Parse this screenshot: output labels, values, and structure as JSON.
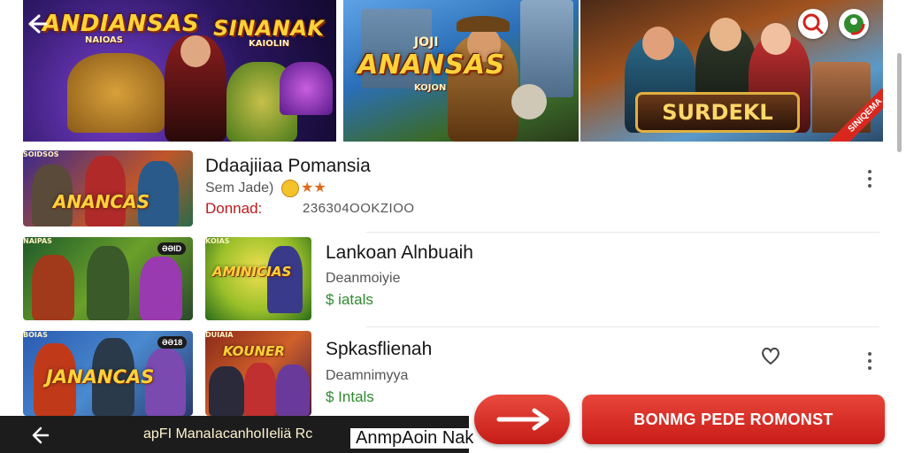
{
  "banners": [
    {
      "logo": "ANDIANSAS",
      "sub": "NAIOAS"
    },
    {
      "logo": "SINANAK",
      "sub": "KAIOLIN"
    },
    {
      "logo": "ANANSAS",
      "top": "JOJI",
      "sub": "KOJON"
    },
    {
      "button": "SURDEKL",
      "ribbon": "SINIQEMA"
    }
  ],
  "header": {
    "back_icon": "arrow-left-icon",
    "search_icon": "search-icon",
    "avatar_icon": "avatar-icon"
  },
  "list": [
    {
      "title": "Ddaajiiaa Pomansia",
      "rating_label": "Sem Jade)",
      "rating_icons": "★★",
      "tag": "Donnad:",
      "meta": "236304OOKZIOO",
      "thumb_logo": "ANANCAS",
      "thumb_sub": "SOIDSOS"
    },
    {
      "title": "Lankoan Alnbuaih",
      "subtitle": "Deanmoiyie",
      "price": "$ iatals",
      "thumb1_logo": "",
      "thumb1_badge": "ƏƏID",
      "thumb1_sub": "NAIPAS",
      "thumb2_logo": "AMINICIAS",
      "thumb2_sub": "KOIAS"
    },
    {
      "title": "Spkasflienah",
      "subtitle": "Deamnimyya",
      "price": "$ Intals",
      "thumb1_logo": "JANANCAS",
      "thumb1_sub": "BOIAS",
      "thumb1_badge": "ƏƏ18",
      "thumb2_logo": "KOUNER",
      "thumb2_sub": "DUIAIA"
    }
  ],
  "bottom": {
    "back_icon": "arrow-left-icon",
    "label": "apFI ManaIacanhoIIeliä Rc",
    "peek_title": "AnmpAoin Nak",
    "arrow_icon": "arrow-right-icon",
    "cta": "BONMG PEDE ROMONST"
  },
  "colors": {
    "accent": "#d2231c",
    "price": "#2e8b2e",
    "tag": "#c0191c"
  }
}
